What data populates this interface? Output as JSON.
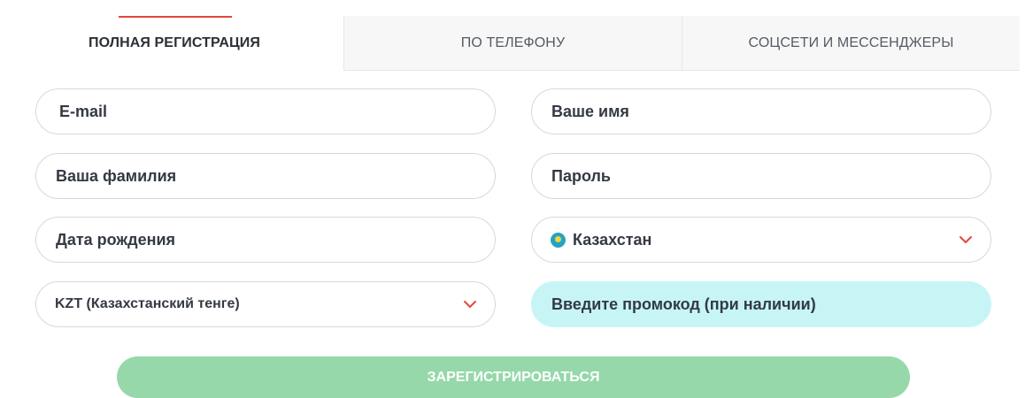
{
  "tabs": [
    {
      "label": "ПОЛНАЯ РЕГИСТРАЦИЯ",
      "active": true
    },
    {
      "label": "ПО ТЕЛЕФОНУ",
      "active": false
    },
    {
      "label": "СОЦСЕТИ И МЕССЕНДЖЕРЫ",
      "active": false
    }
  ],
  "form": {
    "email": {
      "placeholder": "E-mail"
    },
    "first_name": {
      "placeholder": "Ваше имя"
    },
    "last_name": {
      "placeholder": "Ваша фамилия"
    },
    "password": {
      "placeholder": "Пароль"
    },
    "birth_date": {
      "placeholder": "Дата рождения"
    },
    "country": {
      "value": "Казахстан",
      "flag_icon": "kazakhstan-flag-icon"
    },
    "currency": {
      "value": "KZT (Казахстанский тенге)"
    },
    "promo": {
      "placeholder": "Введите промокод (при наличии)"
    },
    "submit_label": "ЗАРЕГИСТРИРОВАТЬСЯ"
  },
  "colors": {
    "accent": "#e2473b",
    "submit_bg": "#96d8a9",
    "promo_bg": "#c7f5f6",
    "chevron": "#e2473b"
  }
}
